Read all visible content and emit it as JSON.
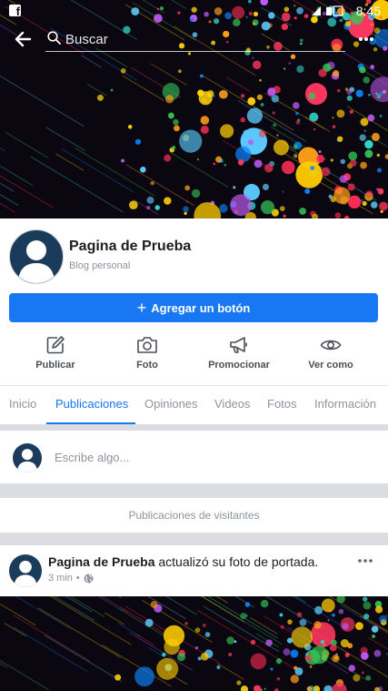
{
  "status_bar": {
    "time": "8:45",
    "app_icon": "facebook-icon"
  },
  "search": {
    "placeholder": "Buscar"
  },
  "page": {
    "name": "Pagina de Prueba",
    "category": "Blog personal"
  },
  "add_button": {
    "label": "Agregar un botón"
  },
  "actions": [
    {
      "label": "Publicar",
      "icon": "edit-icon"
    },
    {
      "label": "Foto",
      "icon": "camera-icon"
    },
    {
      "label": "Promocionar",
      "icon": "megaphone-icon"
    },
    {
      "label": "Ver como",
      "icon": "eye-icon"
    }
  ],
  "tabs": [
    {
      "label": "Inicio",
      "active": false
    },
    {
      "label": "Publicaciones",
      "active": true
    },
    {
      "label": "Opiniones",
      "active": false
    },
    {
      "label": "Videos",
      "active": false
    },
    {
      "label": "Fotos",
      "active": false
    },
    {
      "label": "Información",
      "active": false
    }
  ],
  "composer": {
    "placeholder": "Escribe algo..."
  },
  "visitors": {
    "label": "Publicaciones de visitantes"
  },
  "post": {
    "author": "Pagina de Prueba",
    "action": " actualizó su foto de portada.",
    "time": "3 min",
    "privacy_icon": "globe-icon"
  },
  "colors": {
    "accent": "#1877f2",
    "cover_bg": "#0b0710",
    "avatar_bg": "#1b3b5a"
  }
}
